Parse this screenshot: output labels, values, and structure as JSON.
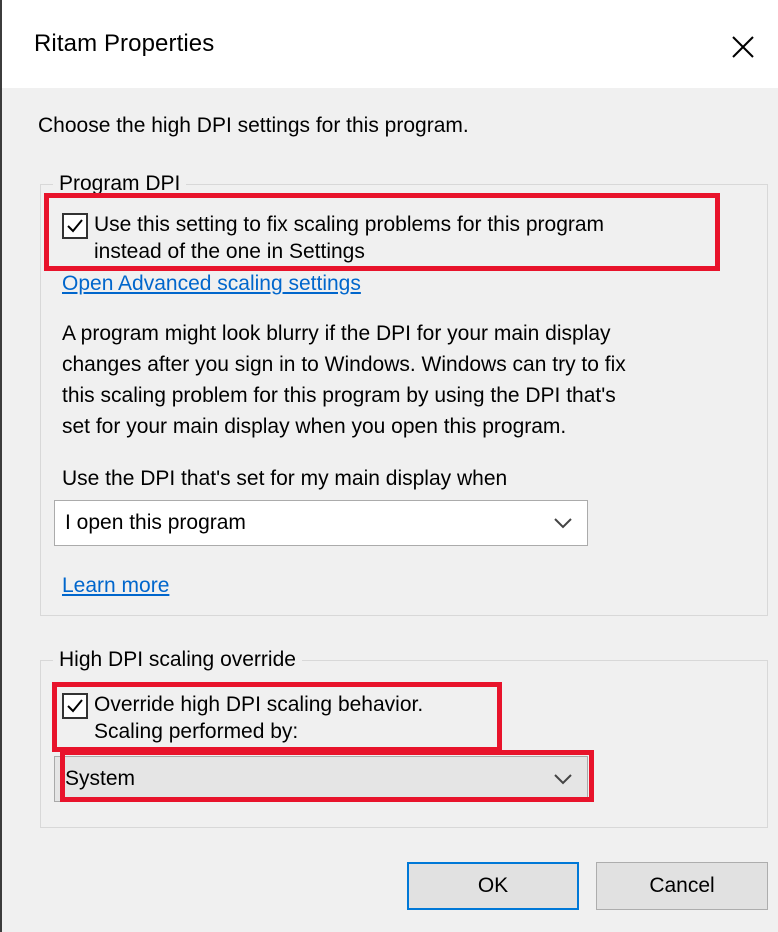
{
  "window": {
    "title": "Ritam Properties",
    "close_icon": "close-icon"
  },
  "intro_text": "Choose the high DPI settings for this program.",
  "program_dpi": {
    "legend": "Program DPI",
    "checkbox": {
      "checked": true,
      "line1": "Use this setting to fix scaling problems for this program",
      "line2": "instead of the one in Settings"
    },
    "advanced_link": "Open Advanced scaling settings",
    "description": [
      "A program might look blurry if the DPI for your main display",
      "changes after you sign in to Windows. Windows can try to fix",
      "this scaling problem for this program by using the DPI that's",
      "set for your main display when you open this program."
    ],
    "dropdown_label": "Use the DPI that's set for my main display when",
    "dropdown_value": "I open this program",
    "learn_more": "Learn more"
  },
  "override": {
    "legend": "High DPI scaling override",
    "checkbox": {
      "checked": true,
      "line1": "Override high DPI scaling behavior.",
      "line2": "Scaling performed by:"
    },
    "dropdown_value": "System"
  },
  "buttons": {
    "ok": "OK",
    "cancel": "Cancel"
  },
  "colors": {
    "highlight": "#e8132b",
    "link": "#0066cc",
    "ok_border": "#0078d7"
  }
}
